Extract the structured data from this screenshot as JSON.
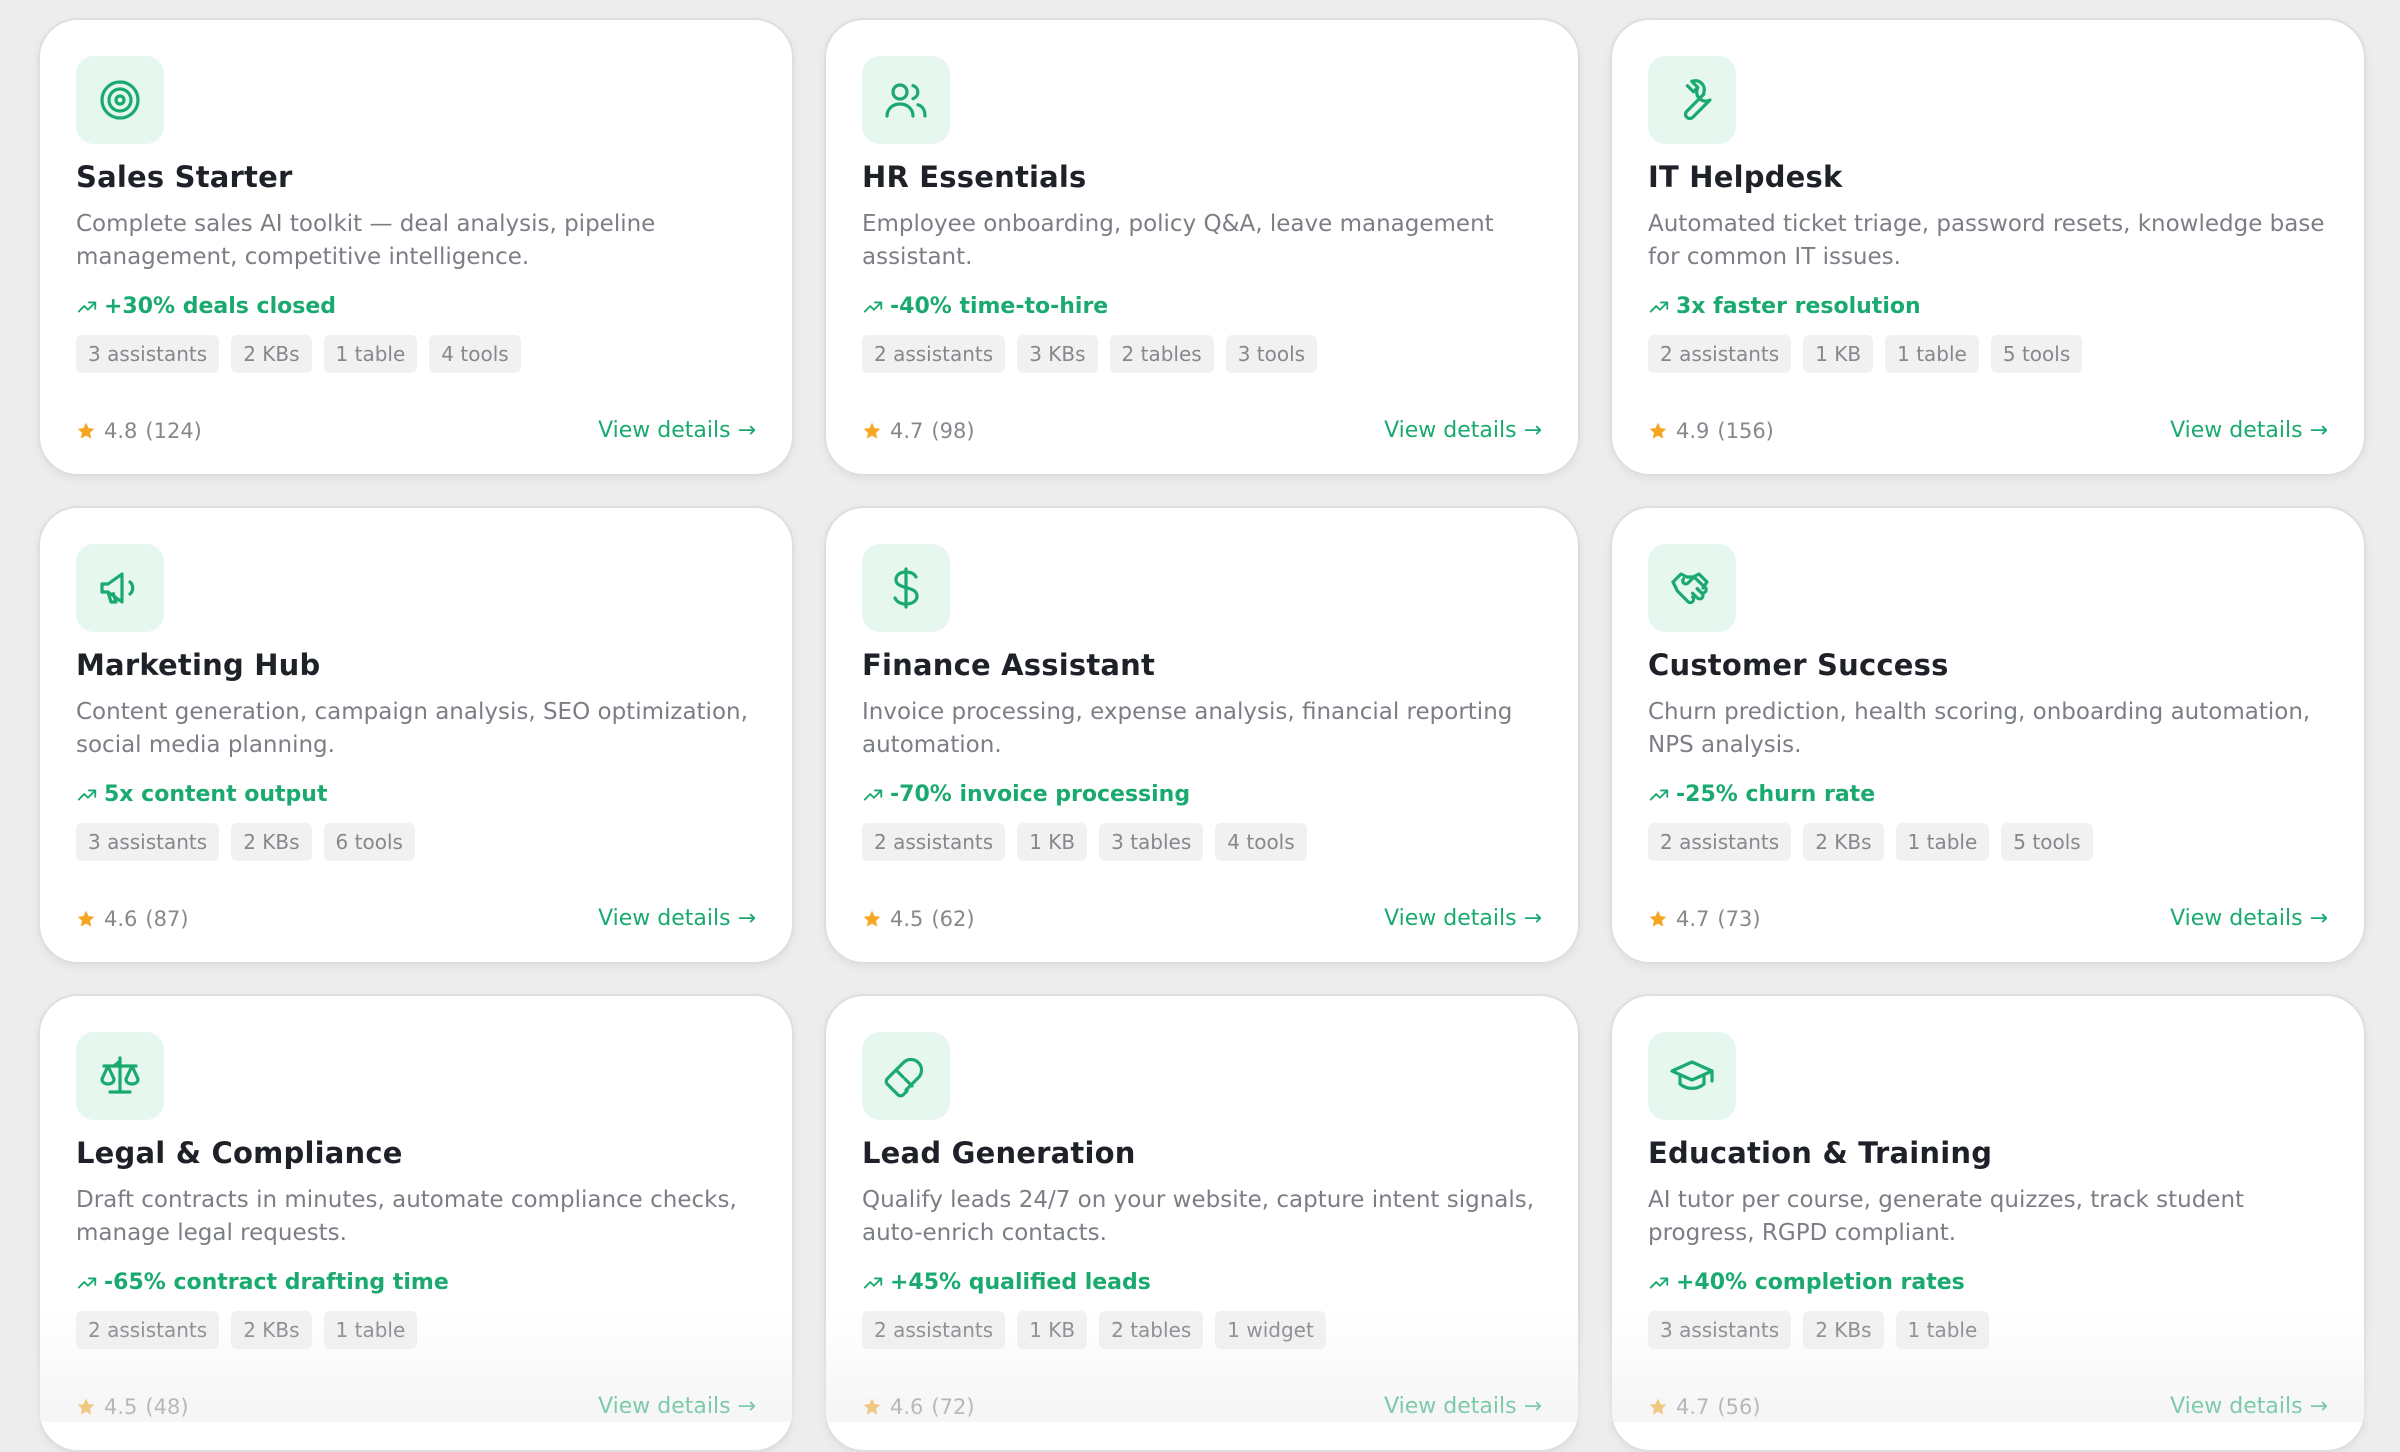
{
  "colors": {
    "accent": "#1aaa6f",
    "star": "#f5a623",
    "icon_bg": "#e6f7ef"
  },
  "cards": [
    {
      "icon": "target-icon",
      "title": "Sales Starter",
      "description": "Complete sales AI toolkit — deal analysis, pipeline management, competitive intelligence.",
      "metric": "+30% deals closed",
      "tags": [
        "3 assistants",
        "2 KBs",
        "1 table",
        "4 tools"
      ],
      "rating": "4.8",
      "reviews": "(124)",
      "cta": "View details →"
    },
    {
      "icon": "users-icon",
      "title": "HR Essentials",
      "description": "Employee onboarding, policy Q&A, leave management assistant.",
      "metric": "-40% time-to-hire",
      "tags": [
        "2 assistants",
        "3 KBs",
        "2 tables",
        "3 tools"
      ],
      "rating": "4.7",
      "reviews": "(98)",
      "cta": "View details →"
    },
    {
      "icon": "wrench-icon",
      "title": "IT Helpdesk",
      "description": "Automated ticket triage, password resets, knowledge base for common IT issues.",
      "metric": "3x faster resolution",
      "tags": [
        "2 assistants",
        "1 KB",
        "1 table",
        "5 tools"
      ],
      "rating": "4.9",
      "reviews": "(156)",
      "cta": "View details →"
    },
    {
      "icon": "megaphone-icon",
      "title": "Marketing Hub",
      "description": "Content generation, campaign analysis, SEO optimization, social media planning.",
      "metric": "5x content output",
      "tags": [
        "3 assistants",
        "2 KBs",
        "6 tools"
      ],
      "rating": "4.6",
      "reviews": "(87)",
      "cta": "View details →"
    },
    {
      "icon": "dollar-icon",
      "title": "Finance Assistant",
      "description": "Invoice processing, expense analysis, financial reporting automation.",
      "metric": "-70% invoice processing",
      "tags": [
        "2 assistants",
        "1 KB",
        "3 tables",
        "4 tools"
      ],
      "rating": "4.5",
      "reviews": "(62)",
      "cta": "View details →"
    },
    {
      "icon": "handshake-icon",
      "title": "Customer Success",
      "description": "Churn prediction, health scoring, onboarding automation, NPS analysis.",
      "metric": "-25% churn rate",
      "tags": [
        "2 assistants",
        "2 KBs",
        "1 table",
        "5 tools"
      ],
      "rating": "4.7",
      "reviews": "(73)",
      "cta": "View details →"
    },
    {
      "icon": "scale-icon",
      "title": "Legal & Compliance",
      "description": "Draft contracts in minutes, automate compliance checks, manage legal requests.",
      "metric": "-65% contract drafting time",
      "tags": [
        "2 assistants",
        "2 KBs",
        "1 table"
      ],
      "rating": "4.5",
      "reviews": "(48)",
      "cta": "View details →"
    },
    {
      "icon": "magnet-icon",
      "title": "Lead Generation",
      "description": "Qualify leads 24/7 on your website, capture intent signals, auto-enrich contacts.",
      "metric": "+45% qualified leads",
      "tags": [
        "2 assistants",
        "1 KB",
        "2 tables",
        "1 widget"
      ],
      "rating": "4.6",
      "reviews": "(72)",
      "cta": "View details →"
    },
    {
      "icon": "graduation-cap-icon",
      "title": "Education & Training",
      "description": "AI tutor per course, generate quizzes, track student progress, RGPD compliant.",
      "metric": "+40% completion rates",
      "tags": [
        "3 assistants",
        "2 KBs",
        "1 table"
      ],
      "rating": "4.7",
      "reviews": "(56)",
      "cta": "View details →"
    }
  ]
}
